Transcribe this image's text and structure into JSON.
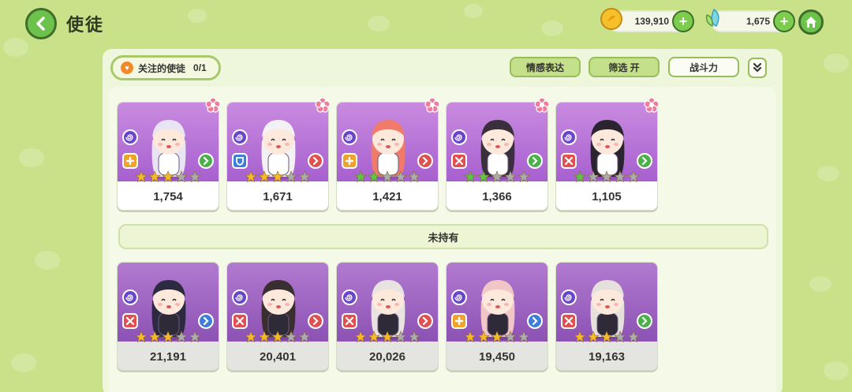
{
  "header": {
    "title": "使徒"
  },
  "currency": {
    "gold": "139,910",
    "crystal": "1,675"
  },
  "toolbar": {
    "follow_label": "关注的使徒",
    "follow_count": "0/1",
    "tab_emotion": "情感表达",
    "tab_filter": "筛选 开",
    "tab_power": "战斗力"
  },
  "section": {
    "unowned_label": "未持有"
  },
  "colors": {
    "background": "#c9e28a",
    "card_purple": "#b06ad6",
    "accent_green": "#6cc24a",
    "star_gold": "#f5b82a",
    "star_green": "#5cc64a",
    "star_grey": "#a9adb2"
  },
  "owned": [
    {
      "power": "1,754",
      "stars": [
        "gold",
        "gold",
        "gold",
        "grey",
        "grey"
      ],
      "role": "plus-icon",
      "role_color": "#f0a22b",
      "arrow_color": "#4ab04a",
      "hair": "#e9e4f4",
      "favorite": true
    },
    {
      "power": "1,671",
      "stars": [
        "gold",
        "gold",
        "gold",
        "grey",
        "grey"
      ],
      "role": "shield-icon",
      "role_color": "#3f7ed8",
      "arrow_color": "#e05050",
      "hair": "#f4f1f4",
      "favorite": true
    },
    {
      "power": "1,421",
      "stars": [
        "green",
        "green",
        "grey",
        "grey",
        "grey"
      ],
      "role": "plus-icon",
      "role_color": "#f0a22b",
      "arrow_color": "#e05050",
      "hair": "#f07b6a",
      "favorite": true
    },
    {
      "power": "1,366",
      "stars": [
        "green",
        "green",
        "grey",
        "grey",
        "grey"
      ],
      "role": "sword-icon",
      "role_color": "#e05050",
      "arrow_color": "#4ab04a",
      "hair": "#3a2f3c",
      "favorite": true
    },
    {
      "power": "1,105",
      "stars": [
        "green",
        "grey",
        "grey",
        "grey",
        "grey"
      ],
      "role": "sword-icon",
      "role_color": "#e05050",
      "arrow_color": "#4ab04a",
      "hair": "#2a2430",
      "favorite": true
    }
  ],
  "unowned": [
    {
      "power": "21,191",
      "stars": [
        "gold",
        "gold",
        "gold",
        "grey",
        "grey"
      ],
      "role": "sword-icon",
      "role_color": "#e05050",
      "arrow_color": "#3f7ed8",
      "hair": "#2b2a40"
    },
    {
      "power": "20,401",
      "stars": [
        "gold",
        "gold",
        "gold",
        "grey",
        "grey"
      ],
      "role": "sword-icon",
      "role_color": "#e05050",
      "arrow_color": "#e05050",
      "hair": "#3a2f30"
    },
    {
      "power": "20,026",
      "stars": [
        "gold",
        "gold",
        "gold",
        "grey",
        "grey"
      ],
      "role": "sword-icon",
      "role_color": "#e05050",
      "arrow_color": "#e05050",
      "hair": "#e8e2e0"
    },
    {
      "power": "19,450",
      "stars": [
        "gold",
        "gold",
        "gold",
        "grey",
        "grey"
      ],
      "role": "plus-icon",
      "role_color": "#f0a22b",
      "arrow_color": "#3f7ed8",
      "hair": "#f2c6c6"
    },
    {
      "power": "19,163",
      "stars": [
        "gold",
        "gold",
        "gold",
        "grey",
        "grey"
      ],
      "role": "sword-icon",
      "role_color": "#e05050",
      "arrow_color": "#4ab04a",
      "hair": "#e6e0dc"
    }
  ]
}
